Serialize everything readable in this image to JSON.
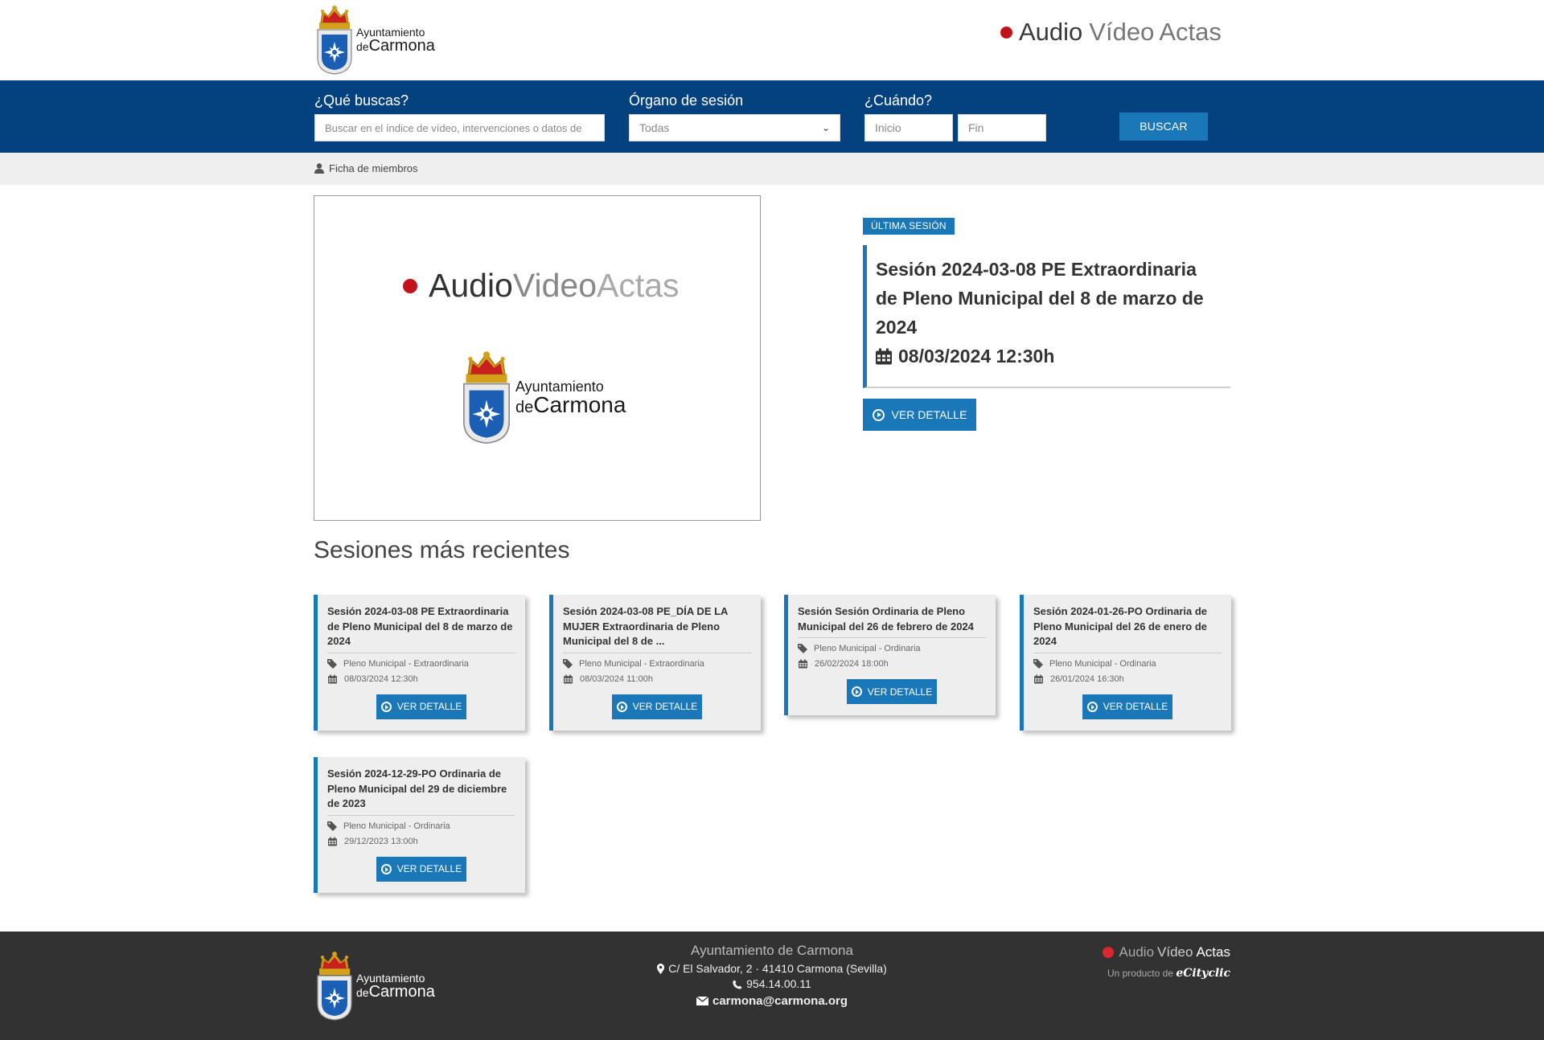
{
  "header": {
    "logo": {
      "line1": "Ayuntamiento",
      "line2_prefix": "de",
      "line2": "Carmona"
    },
    "app_title": {
      "word1": "Audio",
      "word2": "Vídeo",
      "word3": "Actas"
    }
  },
  "search": {
    "what_label": "¿Qué buscas?",
    "what_placeholder": "Buscar en el índice de vídeo, intervenciones o datos de",
    "organ_label": "Órgano de sesión",
    "organ_selected": "Todas",
    "when_label": "¿Cuándo?",
    "start_placeholder": "Inicio",
    "end_placeholder": "Fin",
    "button_label": "BUSCAR"
  },
  "subnav": {
    "members_link": "Ficha de miembros"
  },
  "player": {
    "title": {
      "a": "Audio",
      "b": "Video",
      "c": "Actas"
    },
    "logo": {
      "line1": "Ayuntamiento",
      "line2_prefix": "de",
      "line2": "Carmona"
    }
  },
  "latest": {
    "badge": "ÚLTIMA SESIÓN",
    "title": "Sesión 2024-03-08 PE Extraordinaria de Pleno Municipal del 8 de marzo de 2024",
    "datetime": "08/03/2024 12:30h",
    "button_label": "VER DETALLE"
  },
  "recent": {
    "heading": "Sesiones más recientes",
    "cards": [
      {
        "title": "Sesión 2024-03-08 PE Extraordinaria de Pleno Municipal del 8 de marzo de 2024",
        "category": "Pleno Municipal - Extraordinaria",
        "datetime": "08/03/2024 12:30h",
        "button": "VER DETALLE"
      },
      {
        "title": "Sesión 2024-03-08 PE_DÍA DE LA MUJER Extraordinaria de Pleno Municipal del 8 de ...",
        "category": "Pleno Municipal - Extraordinaria",
        "datetime": "08/03/2024 11:00h",
        "button": "VER DETALLE"
      },
      {
        "title": "Sesión Sesión Ordinaria de Pleno Municipal del 26 de febrero de 2024",
        "category": "Pleno Municipal - Ordinaria",
        "datetime": "26/02/2024 18:00h",
        "button": "VER DETALLE"
      },
      {
        "title": "Sesión 2024-01-26-PO Ordinaria de Pleno Municipal del 26 de enero de 2024",
        "category": "Pleno Municipal - Ordinaria",
        "datetime": "26/01/2024 16:30h",
        "button": "VER DETALLE"
      },
      {
        "title": "Sesión 2024-12-29-PO Ordinaria de Pleno Municipal del 29 de diciembre de 2023",
        "category": "Pleno Municipal - Ordinaria",
        "datetime": "29/12/2023 13:00h",
        "button": "VER DETALLE"
      }
    ]
  },
  "footer": {
    "logo": {
      "line1": "Ayuntamiento",
      "line2_prefix": "de",
      "line2": "Carmona"
    },
    "org_name": "Ayuntamiento de Carmona",
    "address": "C/ El Salvador, 2 · 41410 Carmona (Sevilla)",
    "phone": "954.14.00.11",
    "email": "carmona@carmona.org",
    "app_title": {
      "word1": "Audio",
      "word2": "Vídeo",
      "word3": "Actas"
    },
    "product_prefix": "Un producto de",
    "product_brand": "eCityclic"
  },
  "colors": {
    "navy": "#04417f",
    "accent": "#1a77b8",
    "red_dot": "#c0141a",
    "footer_bg": "#323232"
  },
  "icons": [
    "coat-of-arms-icon",
    "user-icon",
    "chevron-down-icon",
    "calendar-icon",
    "tag-icon",
    "play-circle-icon",
    "map-marker-icon",
    "phone-icon",
    "envelope-icon"
  ]
}
